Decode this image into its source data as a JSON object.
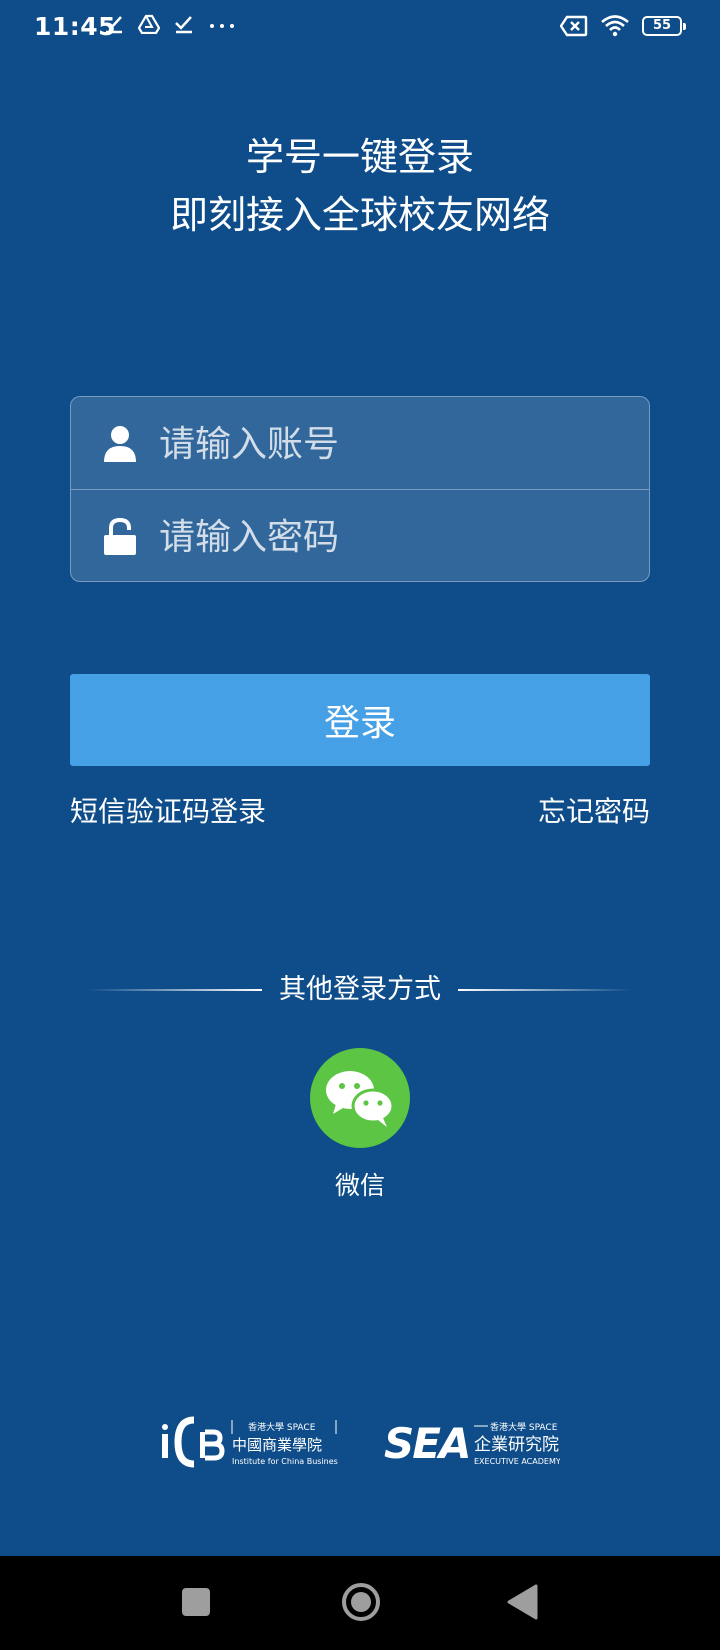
{
  "status_bar": {
    "time": "11:45",
    "battery": "55"
  },
  "headline": {
    "line1": "学号一键登录",
    "line2": "即刻接入全球校友网络"
  },
  "form": {
    "account_placeholder": "请输入账号",
    "password_placeholder": "请输入密码"
  },
  "login_button": "登录",
  "links": {
    "sms_login": "短信验证码登录",
    "forgot_password": "忘记密码"
  },
  "other_login": {
    "label": "其他登录方式",
    "wechat": "微信"
  },
  "logos": {
    "icb_top": "香港大學 SPACE",
    "icb_cn": "中國商業學院",
    "icb_en": "Institute for China Business",
    "sea_top": "香港大學 SPACE",
    "sea_cn": "企業研究院",
    "sea_en": "EXECUTIVE ACADEMY"
  },
  "colors": {
    "background": "#0f4d8a",
    "login_button": "#46a0e6",
    "wechat": "#5cc543"
  }
}
